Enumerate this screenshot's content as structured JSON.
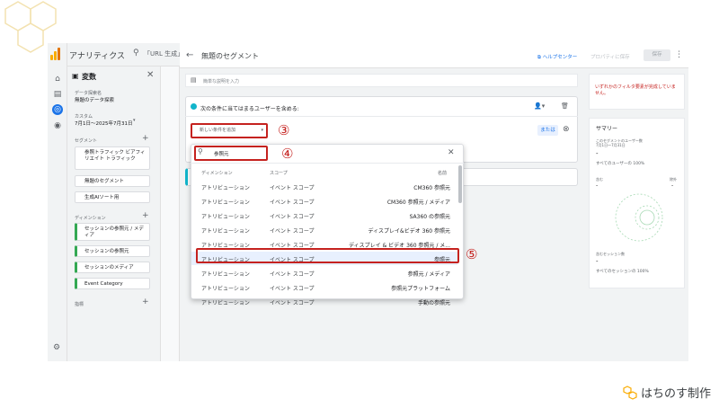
{
  "app": {
    "title": "アナリティクス",
    "search_text": "「URL 生成」"
  },
  "variables_panel": {
    "heading": "変数",
    "explore_label": "データ探索名",
    "explore_name": "無題のデータ探索",
    "custom_label": "カスタム",
    "date_range": "7月1日～2025年7月31日",
    "segments_label": "セグメント",
    "segments": [
      "参照トラフィック ビアフィリエイト トラフィック",
      "無題のセグメント",
      "生成AIソート用"
    ],
    "dimensions_label": "ディメンション",
    "dimensions": [
      "セッションの参照元 / メディア",
      "セッションの参照元",
      "セッションのメディア",
      "Event Category"
    ],
    "metrics_label": "指標"
  },
  "editor": {
    "title": "無題のセグメント",
    "help": "ヘルプセンター",
    "property": "プロパティに保存",
    "save": "保存",
    "description_placeholder": "簡単な説明を入力",
    "condition_title": "次の条件に当てはまるユーザーを含める:",
    "add_condition": "新しい条件を追加",
    "or_label": "または"
  },
  "popup": {
    "search_value": "参照元",
    "columns": {
      "dimension": "ディメンション",
      "scope": "スコープ",
      "name": "名前"
    },
    "rows": [
      {
        "dim": "アトリビューション",
        "scope": "イベント スコープ",
        "name": "CM360 参照元"
      },
      {
        "dim": "アトリビューション",
        "scope": "イベント スコープ",
        "name": "CM360 参照元 / メディア"
      },
      {
        "dim": "アトリビューション",
        "scope": "イベント スコープ",
        "name": "SA360 の参照元"
      },
      {
        "dim": "アトリビューション",
        "scope": "イベント スコープ",
        "name": "ディスプレイ&ビデオ 360 参照元"
      },
      {
        "dim": "アトリビューション",
        "scope": "イベント スコープ",
        "name": "ディスプレイ & ビデオ 360 参照元 / メ..."
      },
      {
        "dim": "アトリビューション",
        "scope": "イベント スコープ",
        "name": "参照元"
      },
      {
        "dim": "アトリビューション",
        "scope": "イベント スコープ",
        "name": "参照元 / メディア"
      },
      {
        "dim": "アトリビューション",
        "scope": "イベント スコープ",
        "name": "参照元プラットフォーム"
      },
      {
        "dim": "アトリビューション",
        "scope": "イベント スコープ",
        "name": "手動の参照元"
      }
    ]
  },
  "summary": {
    "warning": "いずれかのフィルタ要素が完成していません。",
    "title": "サマリー",
    "users_label": "このセグメントのユーザー数",
    "users_range": "7月1日～7月31日",
    "users_value": "-",
    "users_pct": "すべてのユーザーの 100%",
    "left_label": "含む",
    "right_label": "除外",
    "sessions_label": "含むセッション数",
    "sessions_value": "-",
    "sessions_pct": "すべてのセッションの 100%"
  },
  "annotations": {
    "n3": "③",
    "n4": "④",
    "n5": "⑤"
  },
  "brand": {
    "name": "はちのす制作"
  },
  "colors": {
    "accent": "#1a73e8",
    "highlight": "#c5221f",
    "ga_orange": "#f9ab00"
  }
}
